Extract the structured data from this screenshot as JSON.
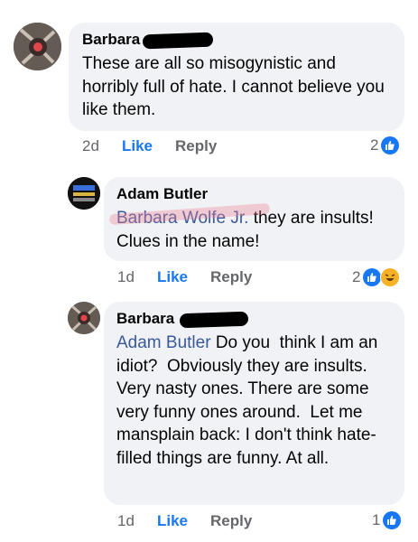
{
  "comments": [
    {
      "author": "Barbara",
      "text": "These are all so misogynistic and horribly full of hate. I cannot believe you like them.",
      "time": "2d",
      "like_label": "Like",
      "reply_label": "Reply",
      "reaction_count": "2"
    },
    {
      "author": "Adam Butler",
      "mention": "Barbara Wolfe Jr.",
      "text": " they are insults! Clues in the name!",
      "time": "1d",
      "like_label": "Like",
      "reply_label": "Reply",
      "reaction_count": "2"
    },
    {
      "author": "Barbara",
      "mention": "Adam Butler",
      "text": " Do you  think I am an idiot?  Obviously they are insults. Very nasty ones. There are some very funny ones around.  Let me mansplain back: I don't think hate-filled things are funny. At all.",
      "time": "1d",
      "like_label": "Like",
      "reply_label": "Reply",
      "reaction_count": "1"
    }
  ],
  "colors": {
    "bubble": "#f0f2f5",
    "like_blue": "#1877f2",
    "mention": "#3b5998",
    "meta_gray": "#65676b"
  },
  "icons": [
    "like-reaction-icon",
    "haha-reaction-icon"
  ]
}
